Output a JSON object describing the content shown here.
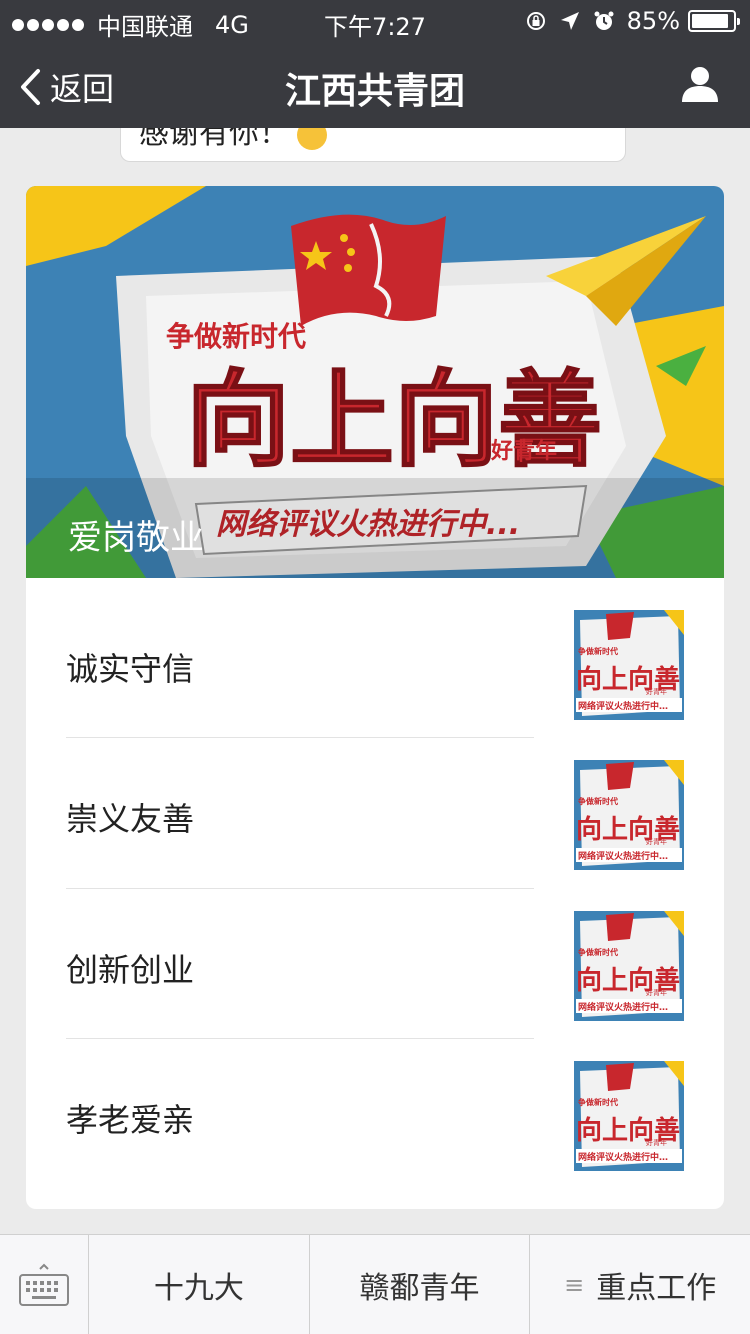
{
  "status_bar": {
    "carrier": "中国联通",
    "network": "4G",
    "time": "下午7:27",
    "battery": "85%"
  },
  "nav": {
    "back_label": "返回",
    "title": "江西共青团",
    "icons": [
      "chevron-left-icon",
      "user-icon"
    ]
  },
  "chat_peek": {
    "text": "感谢有你！"
  },
  "article_card": {
    "cover": {
      "caption": "爱岗敬业",
      "poster": {
        "line1": "争做新时代",
        "line2": "向上向善",
        "line3": "好青年",
        "line4": "网络评议火热进行中..."
      }
    },
    "items": [
      {
        "title": "诚实守信"
      },
      {
        "title": "崇义友善"
      },
      {
        "title": "创新创业"
      },
      {
        "title": "孝老爱亲"
      }
    ]
  },
  "bottom_menu": {
    "keyboard_icon": "keyboard-icon",
    "items": [
      "十九大",
      "赣鄱青年",
      "重点工作"
    ],
    "submenu_icon": "≡"
  },
  "colors": {
    "bar_bg": "#393a3f",
    "page_bg": "#ebebeb",
    "poster_red": "#c8272d",
    "poster_blue": "#3d82b5",
    "poster_yellow": "#f6c518"
  }
}
